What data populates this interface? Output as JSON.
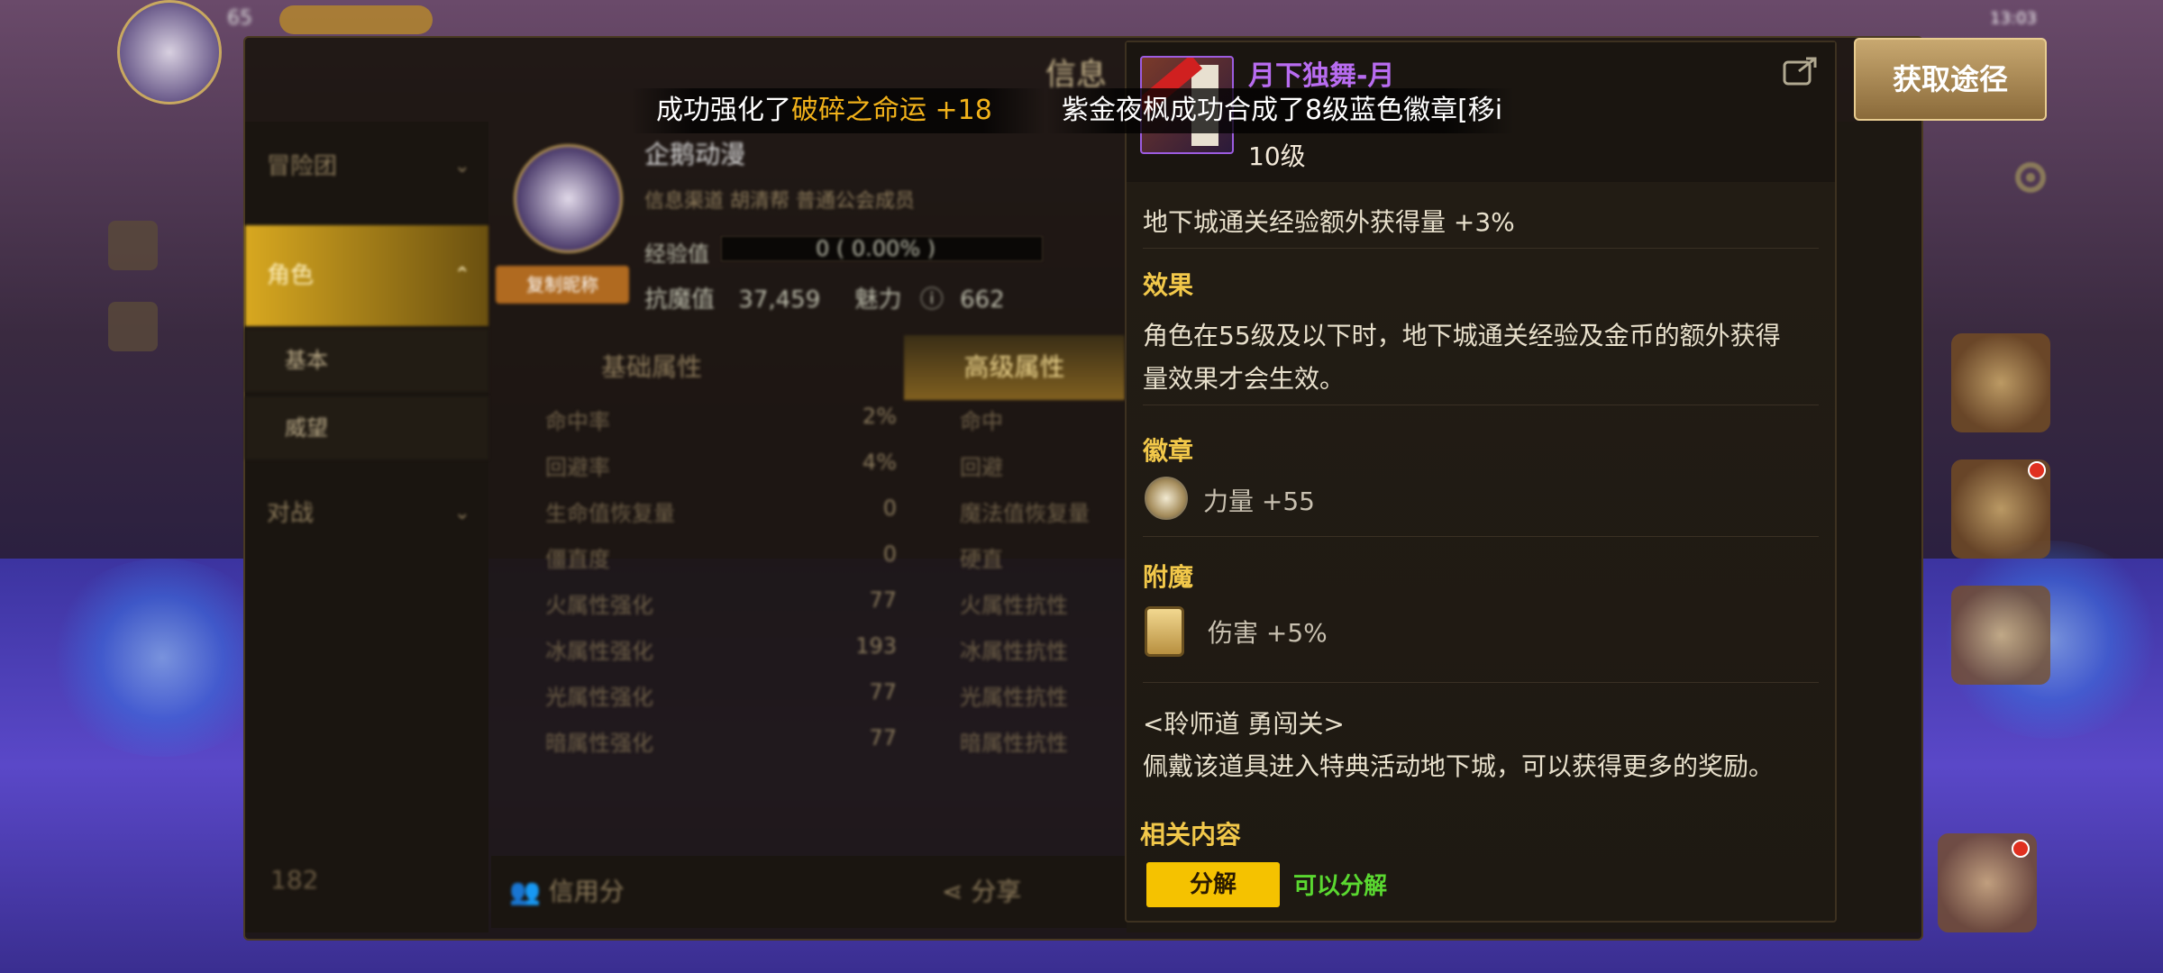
{
  "background": {
    "hud_level": "65",
    "status_time": "13:03"
  },
  "panel": {
    "title": "信息",
    "nav": {
      "adventure": "冒险团",
      "character": "角色",
      "basic": "基本",
      "prestige": "威望",
      "pvp": "对战",
      "bottom": "182"
    },
    "character": {
      "name": "企鹅动漫",
      "copy_button": "复制昵称",
      "guild_line": "信息渠道  胡清帮  普通公会成员",
      "exp_label": "经验值",
      "exp_value": "0 ( 0.00% )",
      "power_label": "抗魔值",
      "power_value": "37,459",
      "charm_label": "魅力",
      "charm_value": "662"
    },
    "tabs": [
      "基础属性",
      "高级属性"
    ],
    "attributes": [
      {
        "name": "命中率",
        "value": "2%",
        "right": "命中"
      },
      {
        "name": "回避率",
        "value": "4%",
        "right": "回避"
      },
      {
        "name": "生命值恢复量",
        "value": "0",
        "right": "魔法值恢复量"
      },
      {
        "name": "僵直度",
        "value": "0",
        "right": "硬直"
      },
      {
        "name": "火属性强化",
        "value": "77",
        "right": "火属性抗性"
      },
      {
        "name": "冰属性强化",
        "value": "193",
        "right": "冰属性抗性"
      },
      {
        "name": "光属性强化",
        "value": "77",
        "right": "光属性抗性"
      },
      {
        "name": "暗属性强化",
        "value": "77",
        "right": "暗属性抗性"
      }
    ],
    "bottom": {
      "credit": "信用分",
      "share": "分享"
    }
  },
  "tooltip": {
    "item_name": "月下独舞-月",
    "item_level": "10级",
    "bonus_line": "地下城通关经验额外获得量 +3%",
    "effect_heading": "效果",
    "effect_text_1": "角色在55级及以下时，地下城通关经验及金币的额外获得",
    "effect_text_2": "量效果才会生效。",
    "badge_heading": "徽章",
    "badge_mod": "力量 +55",
    "enchant_heading": "附魔",
    "enchant_mod": "伤害 +5%",
    "flavor_title": "<聆师道 勇闯关>",
    "flavor_text": "佩戴该道具进入特典活动地下城，可以获得更多的奖励。",
    "related_heading": "相关内容",
    "decompose_button": "分解",
    "decompose_note": "可以分解"
  },
  "acquire_button": "获取途径",
  "notifications": {
    "left_prefix": "成功强化了",
    "left_highlight": "破碎之命运 +18",
    "right": "紫金夜枫成功合成了8级蓝色徽章[移i"
  },
  "colors": {
    "item_purple": "#b86cf0",
    "heading_gold": "#f2c84a",
    "decompose_yellow": "#f5c200",
    "decompose_green": "#5ad830",
    "notify_highlight": "#f2b21a"
  }
}
